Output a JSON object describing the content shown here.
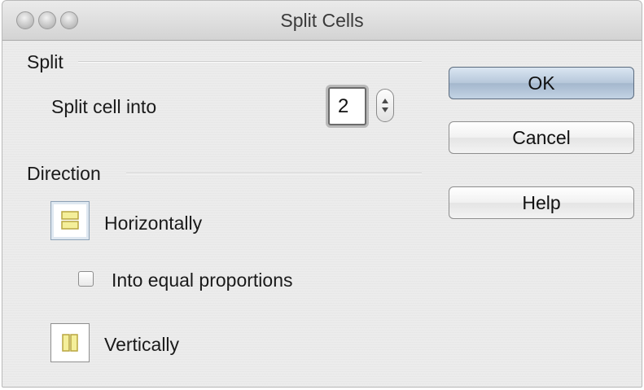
{
  "window": {
    "title": "Split Cells"
  },
  "split": {
    "section_label": "Split",
    "split_cell_label": "Split cell into",
    "value": "2"
  },
  "direction": {
    "section_label": "Direction",
    "horizontal_label": "Horizontally",
    "horizontal_selected": true,
    "equal_label": "Into equal proportions",
    "equal_checked": false,
    "vertical_label": "Vertically"
  },
  "buttons": {
    "ok": "OK",
    "cancel": "Cancel",
    "help": "Help"
  },
  "icons": {
    "close": "close-button-icon",
    "minimize": "minimize-button-icon",
    "zoom": "zoom-button-icon",
    "horizontal": "split-horizontal-icon",
    "vertical": "split-vertical-icon",
    "spinner": "stepper-arrows-icon"
  },
  "colors": {
    "icon_fill": "#f4ef9a",
    "icon_stroke": "#b8a640",
    "default_button": "#b6c7da"
  }
}
